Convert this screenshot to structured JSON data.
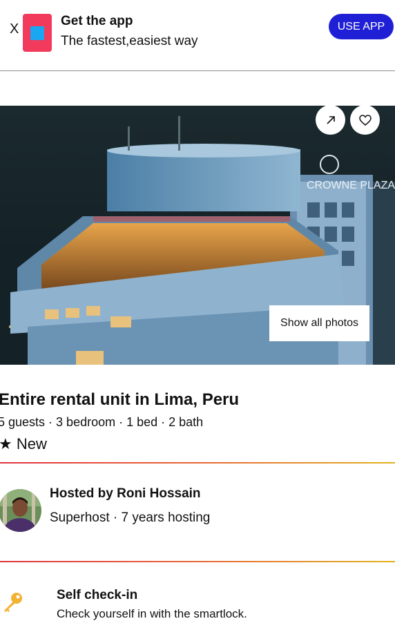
{
  "banner": {
    "close_label": "X",
    "title": "Get the app",
    "subtitle": "The fastest,easiest way",
    "button_label": "USE APP",
    "icon_colors": {
      "outer": "#f23a5c",
      "inner": "#1aa6f0"
    },
    "button_color": "#1f1fd6"
  },
  "hero": {
    "building_sign": "CROWNE PLAZA",
    "show_all_photos_label": "Show all photos",
    "share_icon": "arrow-up-right-icon",
    "favorite_icon": "heart-icon"
  },
  "listing": {
    "title": "Entire rental unit in Lima, Peru",
    "details": "5 guests · 3 bedroom · 1 bed · 2 bath",
    "rating_star": "★",
    "rating_text": "New"
  },
  "host": {
    "title": "Hosted by Roni Hossain",
    "subtitle": "Superhost · 7 years hosting"
  },
  "features": [
    {
      "icon": "key-icon",
      "title": "Self check-in",
      "description": "Check yourself in with the smartlock."
    }
  ]
}
